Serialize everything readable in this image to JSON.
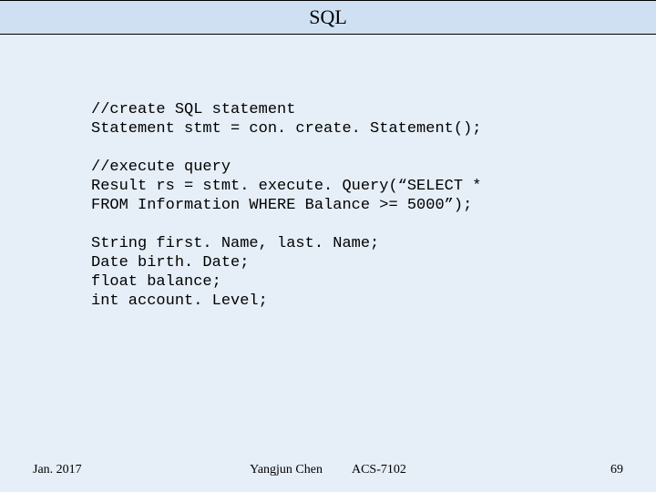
{
  "title": "SQL",
  "code": "//create SQL statement\nStatement stmt = con. create. Statement();\n\n//execute query\nResult rs = stmt. execute. Query(“SELECT *\nFROM Information WHERE Balance >= 5000”);\n\nString first. Name, last. Name;\nDate birth. Date;\nfloat balance;\nint account. Level;",
  "footer": {
    "date": "Jan. 2017",
    "author": "Yangjun Chen",
    "course": "ACS-7102",
    "page": "69"
  }
}
